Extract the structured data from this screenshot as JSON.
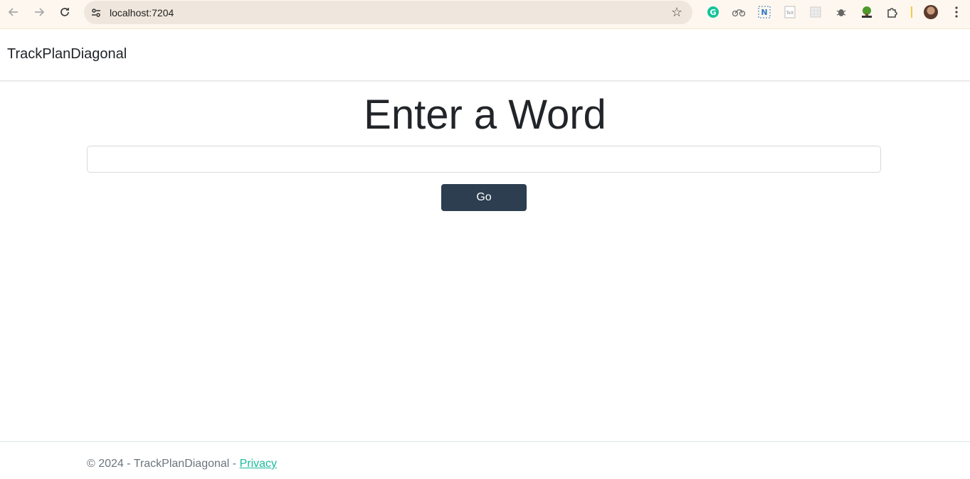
{
  "browser": {
    "url": "localhost:7204",
    "icons": {
      "back": "arrow-left",
      "forward": "arrow-right",
      "reload": "reload",
      "site_info": "tune",
      "bookmark": "star",
      "menu": "kebab"
    }
  },
  "navbar": {
    "brand": "TrackPlanDiagonal"
  },
  "main": {
    "title": "Enter a Word",
    "input_value": "",
    "input_placeholder": "",
    "go_label": "Go"
  },
  "footer": {
    "copyright": "© 2024 - TrackPlanDiagonal - ",
    "privacy_label": "Privacy"
  },
  "colors": {
    "primary_button": "#2c3e50",
    "link": "#18bc9c",
    "chrome_bg": "#fdf7ef",
    "omnibox_bg": "#efe7dd"
  }
}
